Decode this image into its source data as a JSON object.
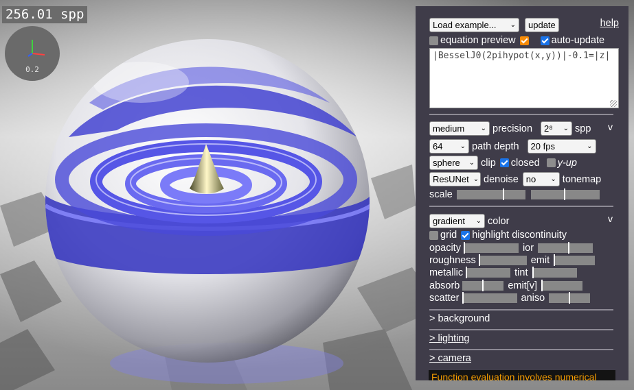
{
  "viewport": {
    "spp_readout": "256.01 spp",
    "axes_value": "0.2"
  },
  "panel": {
    "load_example": "Load example...",
    "update": "update",
    "help": "help",
    "equation_preview": "equation preview",
    "auto_update": "auto-update",
    "equation": "|BesselJ0(2pihypot(x,y))|-0.1=|z|",
    "render": {
      "precision_value": "medium",
      "precision_label": "precision",
      "spp_value": "2⁸",
      "spp_label": "spp",
      "toggle": "v",
      "path_depth_value": "64",
      "path_depth_label": "path depth",
      "fps_value": "20 fps",
      "clip_value": "sphere",
      "clip_label": "clip",
      "closed_label": "closed",
      "yup_label": "y-up",
      "denoise_value": "ResUNet",
      "denoise_label": "denoise",
      "tonemap_value": "no",
      "tonemap_label": "tonemap",
      "scale_label": "scale"
    },
    "material": {
      "color_value": "gradient",
      "color_label": "color",
      "toggle": "v",
      "grid_label": "grid",
      "highlight_label": "highlight discontinuity",
      "opacity": "opacity",
      "ior": "ior",
      "roughness": "roughness",
      "emit": "emit",
      "metallic": "metallic",
      "tint": "tint",
      "absorb": "absorb",
      "emit_v": "emit[v]",
      "scatter": "scatter",
      "aniso": "aniso"
    },
    "sections": {
      "background": "> background",
      "lighting": "> lighting",
      "camera": "> camera"
    },
    "warning": "Function evaluation involves numerical"
  }
}
